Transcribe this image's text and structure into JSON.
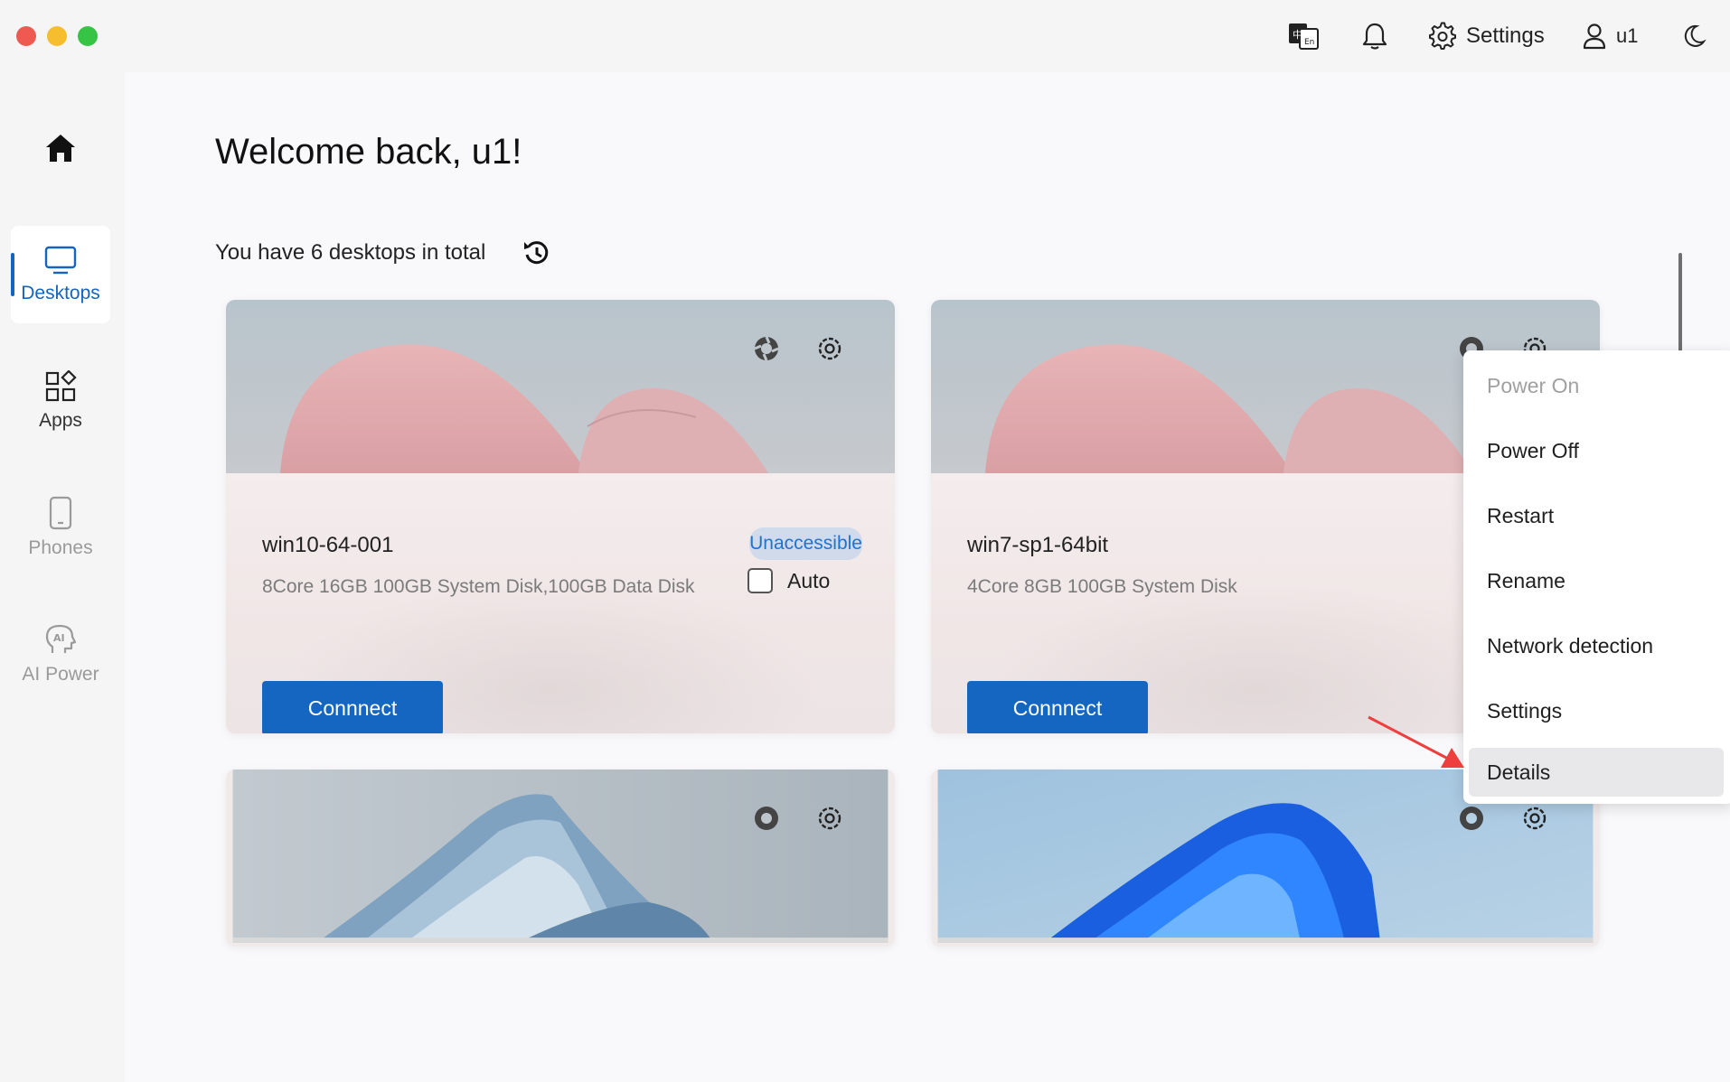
{
  "titlebar": {
    "language_icon": "language-toggle-icon",
    "notification_icon": "bell-icon",
    "settings_label": "Settings",
    "user_label": "u1",
    "theme_icon": "moon-icon"
  },
  "sidebar": {
    "items": [
      {
        "label": "",
        "icon": "home-icon"
      },
      {
        "label": "Desktops",
        "icon": "monitor-icon"
      },
      {
        "label": "Apps",
        "icon": "apps-icon"
      },
      {
        "label": "Phones",
        "icon": "phone-icon"
      },
      {
        "label": "AI Power",
        "icon": "ai-head-icon"
      }
    ]
  },
  "main": {
    "welcome": "Welcome back, u1!",
    "desktop_count": "You have 6 desktops in total"
  },
  "cards": [
    {
      "name": "win10-64-001",
      "spec": "8Core 16GB 100GB System Disk,100GB Data Disk",
      "status": "Unaccessible",
      "auto_label": "Auto",
      "auto_checked": false,
      "connect_label": "Connnect"
    },
    {
      "name": "win7-sp1-64bit",
      "spec": "4Core 8GB 100GB System Disk",
      "connect_label": "Connnect"
    }
  ],
  "context_menu": {
    "items": [
      {
        "label": "Power On",
        "disabled": true
      },
      {
        "label": "Power Off",
        "disabled": false
      },
      {
        "label": "Restart",
        "disabled": false
      },
      {
        "label": "Rename",
        "disabled": false
      },
      {
        "label": "Network detection",
        "disabled": false
      },
      {
        "label": "Settings",
        "disabled": false
      },
      {
        "label": "Details",
        "disabled": false,
        "highlighted": true
      }
    ]
  },
  "colors": {
    "accent": "#1565c0",
    "button": "#1466c0",
    "status_text": "#1e73d2",
    "annotation_arrow": "#ef3e3e"
  }
}
